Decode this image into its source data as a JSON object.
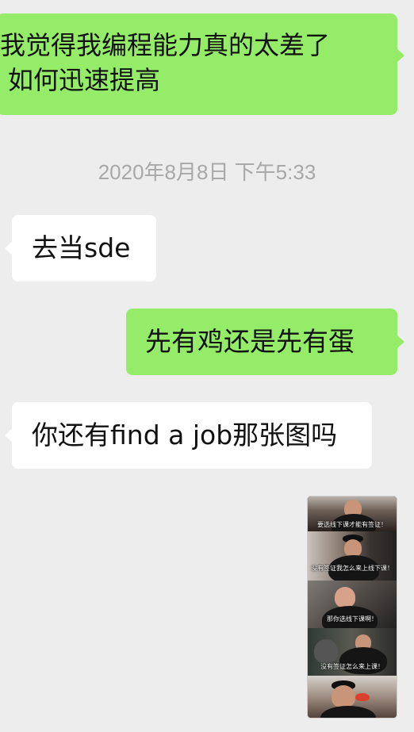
{
  "messages": [
    {
      "side": "out",
      "text_line1": "我觉得我编程能力真的太差了",
      "text_line2": "如何迅速提高"
    },
    {
      "side": "in",
      "text": "去当sde"
    },
    {
      "side": "out",
      "text": "先有鸡还是先有蛋"
    },
    {
      "side": "in",
      "text": "你还有find a job那张图吗"
    }
  ],
  "timestamp": "2020年8月8日 下午5:33",
  "meme": {
    "captions": [
      "要选线下课才能有签证！",
      "没有签证我怎么来上线下课！",
      "那你选线下课啊！",
      "没有签证怎么来上课！"
    ]
  },
  "colors": {
    "background": "#ededed",
    "outgoing_bubble": "#95ec69",
    "incoming_bubble": "#ffffff",
    "timestamp": "#a8a8a8"
  }
}
